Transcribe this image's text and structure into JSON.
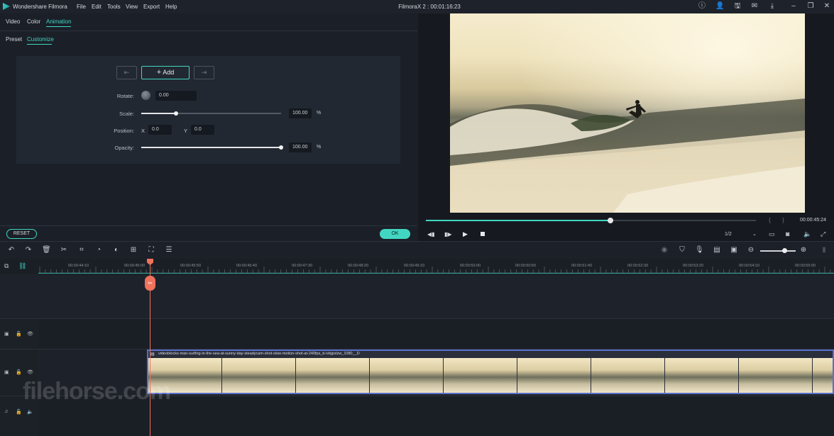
{
  "app": {
    "name": "Wondershare Filmora",
    "menu": [
      "File",
      "Edit",
      "Tools",
      "View",
      "Export",
      "Help"
    ],
    "project_title": "FilmoraX 2 : 00:01:16:23"
  },
  "editor": {
    "tabs": [
      "Video",
      "Color",
      "Animation"
    ],
    "active_tab": "Animation",
    "subtabs": [
      "Preset",
      "Customize"
    ],
    "active_subtab": "Customize",
    "add_label": "Add",
    "rotate": {
      "label": "Rotate:",
      "value": "0.00"
    },
    "scale": {
      "label": "Scale:",
      "value": "100.00",
      "unit": "%",
      "level": 0.25
    },
    "position": {
      "label": "Position:",
      "x_label": "X",
      "x_value": "0.0",
      "y_label": "Y",
      "y_value": "0.0"
    },
    "opacity": {
      "label": "Opacity:",
      "value": "100.00",
      "unit": "%",
      "level": 1.0
    },
    "reset_label": "RESET",
    "ok_label": "OK"
  },
  "preview": {
    "timecode": "00:00:45:24",
    "progress": 0.56,
    "quality": "1/2",
    "bracket_in": "{",
    "bracket_out": "}"
  },
  "timeline": {
    "ruler": [
      "00:00:44:10",
      "00:00:45:00",
      "00:00:45:50",
      "00:00:46:40",
      "00:00:47:30",
      "00:00:48:20",
      "00:00:49:10",
      "00:00:50:00",
      "00:00:50:50",
      "00:00:51:40",
      "00:00:52:30",
      "00:00:53:20",
      "00:00:54:10",
      "00:00:55:00"
    ],
    "clip_name": "videoblocks-man-surfing-in-the-sea-at-sunny-day-steadycam-shot-slow-motion-shot-at-240fps_b-ivbjpxlzw_1080__D"
  },
  "watermark": "filehorse.com",
  "colors": {
    "accent": "#42d6c2",
    "playhead": "#f0715c",
    "clip_border": "#5b6fc8"
  }
}
